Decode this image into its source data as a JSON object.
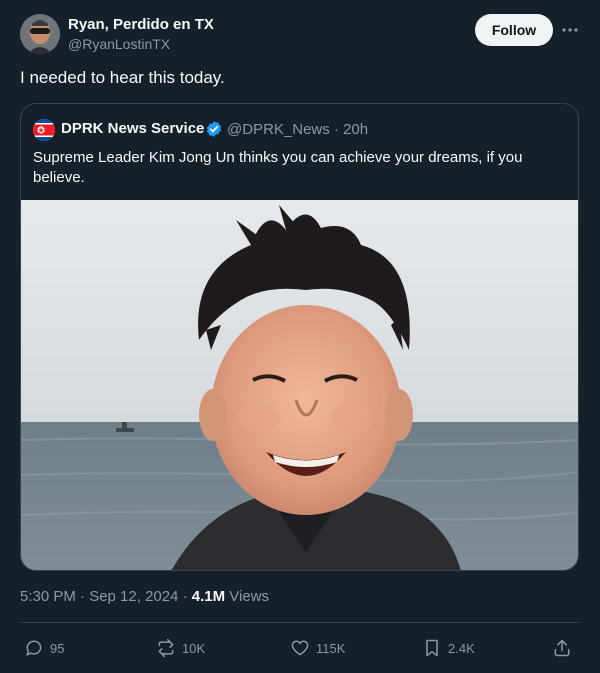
{
  "author": {
    "name": "Ryan, Perdido en TX",
    "handle": "@RyanLostinTX",
    "follow_label": "Follow"
  },
  "tweet": {
    "text": "I needed to hear this today."
  },
  "quoted": {
    "name": "DPRK News Service",
    "handle_time": "@DPRK_News · 20h",
    "text": "Supreme Leader Kim Jong Un thinks you can achieve your dreams, if you believe."
  },
  "meta": {
    "timestamp": "5:30 PM · Sep 12, 2024 · ",
    "views_count": "4.1M",
    "views_label": " Views"
  },
  "actions": {
    "replies": "95",
    "reposts": "10K",
    "likes": "115K",
    "bookmarks": "2.4K"
  },
  "colors": {
    "background": "#15202b",
    "text_primary": "#f7f9f9",
    "text_secondary": "#8b98a5",
    "border": "#38444d",
    "verified": "#1d9bf0"
  }
}
